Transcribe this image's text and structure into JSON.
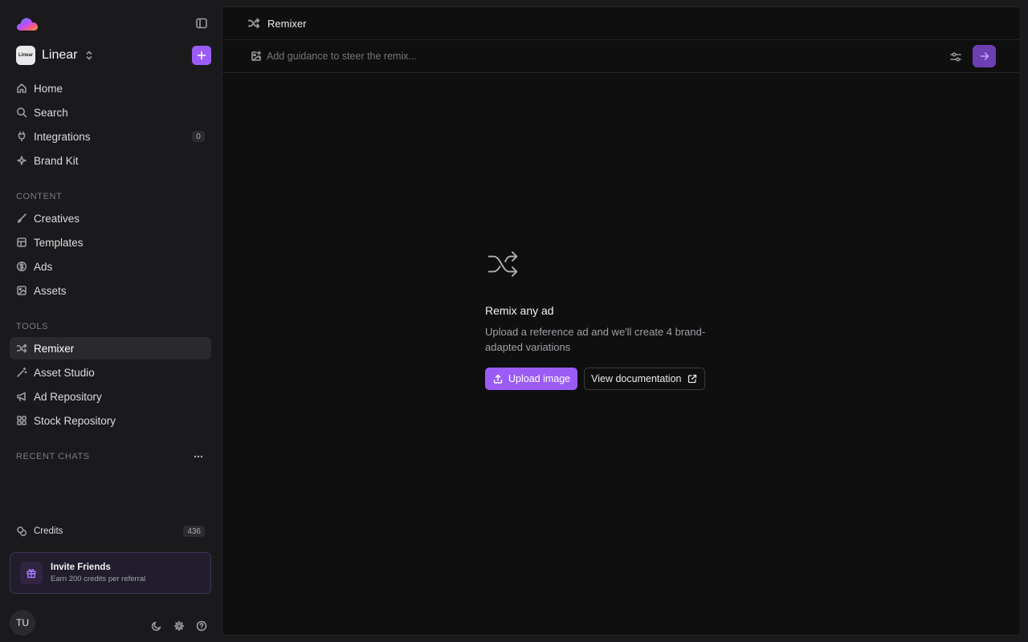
{
  "workspace": {
    "avatar_text": "Linear",
    "name": "Linear"
  },
  "nav": {
    "home": "Home",
    "search": "Search",
    "integrations": "Integrations",
    "integrations_count": "0",
    "brand_kit": "Brand Kit"
  },
  "content_section": {
    "label": "CONTENT",
    "creatives": "Creatives",
    "templates": "Templates",
    "ads": "Ads",
    "assets": "Assets"
  },
  "tools_section": {
    "label": "TOOLS",
    "remixer": "Remixer",
    "asset_studio": "Asset Studio",
    "ad_repository": "Ad Repository",
    "stock_repository": "Stock Repository"
  },
  "recent_chats": {
    "label": "RECENT CHATS"
  },
  "credits": {
    "label": "Credits",
    "count": "436"
  },
  "invite": {
    "title": "Invite Friends",
    "subtitle": "Earn 200 credits per referral"
  },
  "user": {
    "initials": "TU"
  },
  "header": {
    "title": "Remixer"
  },
  "guidance": {
    "placeholder": "Add guidance to steer the remix..."
  },
  "empty_state": {
    "title": "Remix any ad",
    "description": "Upload a reference ad and we'll create 4 brand-adapted variations",
    "upload_label": "Upload image",
    "docs_label": "View documentation"
  },
  "colors": {
    "accent": "#9b5cf6",
    "send_button": "#6c3fb2",
    "background": "#1a1a1c",
    "panel": "#0f0f10"
  },
  "icons": [
    "cloud-logo-icon",
    "sidebar-toggle-icon",
    "chevron-updown-icon",
    "plus-icon",
    "home-icon",
    "search-icon",
    "plug-icon",
    "sparkle-icon",
    "brush-icon",
    "template-icon",
    "dollar-icon",
    "image-icon",
    "shuffle-icon",
    "wand-icon",
    "megaphone-icon",
    "grid-icon",
    "ellipsis-icon",
    "credits-icon",
    "gift-icon",
    "moon-icon",
    "gear-icon",
    "help-icon",
    "image-plus-icon",
    "sliders-icon",
    "arrow-right-icon",
    "upload-icon",
    "external-link-icon"
  ]
}
